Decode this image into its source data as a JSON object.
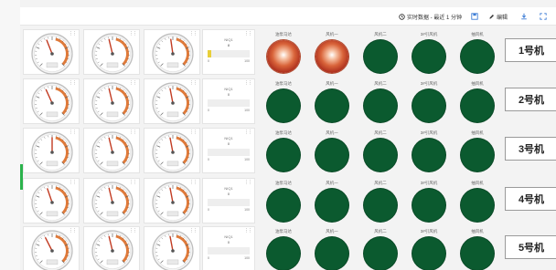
{
  "toolbar": {
    "realtime_label": "实时数据 - 最近 1 分钟",
    "edit_label": "编辑",
    "icons": [
      "clock-icon",
      "save-icon",
      "edit-icon",
      "download-icon",
      "fullscreen-icon"
    ]
  },
  "colors": {
    "indicator_on": "#c0452a",
    "indicator_off": "#0b5a2f",
    "bar_fill": "#e8cf3a",
    "gauge_accent": "#e07a3a"
  },
  "indicator_labels": [
    "油泵马达",
    "风机一",
    "风机二",
    "3#引风机",
    "抽风机"
  ],
  "units": [
    {
      "button_label": "1号机",
      "gauges": [
        {
          "value": 0.42
        },
        {
          "value": 0.45
        },
        {
          "value": 0.47
        }
      ],
      "bar": {
        "title": "NIQ1",
        "value": "8",
        "min": "0",
        "max": "100",
        "fill": 0.08
      },
      "indicators": [
        "on",
        "on",
        "off",
        "off",
        "off"
      ]
    },
    {
      "button_label": "2号机",
      "gauges": [
        {
          "value": 0.41
        },
        {
          "value": 0.45
        },
        {
          "value": 0.46
        }
      ],
      "bar": {
        "title": "NIQ1",
        "value": "0",
        "min": "0",
        "max": "100",
        "fill": 0.0
      },
      "indicators": [
        "off",
        "off",
        "off",
        "off",
        "off"
      ]
    },
    {
      "button_label": "3号机",
      "gauges": [
        {
          "value": 0.5
        },
        {
          "value": 0.45
        },
        {
          "value": 0.46
        }
      ],
      "bar": {
        "title": "NIQ1",
        "value": "0",
        "min": "0",
        "max": "100",
        "fill": 0.0
      },
      "indicators": [
        "off",
        "off",
        "off",
        "off",
        "off"
      ]
    },
    {
      "button_label": "4号机",
      "gauges": [
        {
          "value": 0.43
        },
        {
          "value": 0.45
        },
        {
          "value": 0.46
        }
      ],
      "bar": {
        "title": "NIQ1",
        "value": "0",
        "min": "0",
        "max": "100",
        "fill": 0.0
      },
      "indicators": [
        "off",
        "off",
        "off",
        "off",
        "off"
      ]
    },
    {
      "button_label": "5号机",
      "gauges": [
        {
          "value": 0.4
        },
        {
          "value": 0.45
        },
        {
          "value": 0.46
        }
      ],
      "bar": {
        "title": "NIQ1",
        "value": "0",
        "min": "0",
        "max": "100",
        "fill": 0.0
      },
      "indicators": [
        "off",
        "off",
        "off",
        "off",
        "off"
      ]
    }
  ]
}
